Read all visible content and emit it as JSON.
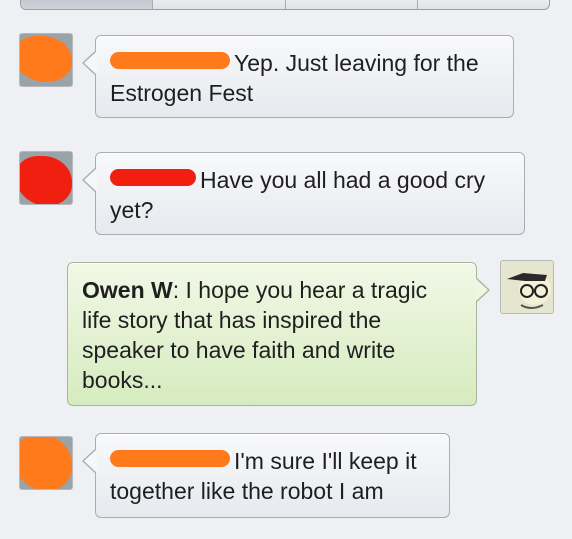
{
  "colors": {
    "orange_redaction": "#ff7a1a",
    "red_redaction": "#f01f10",
    "outgoing_bubble": "#dcefc8",
    "incoming_bubble": "#eef0f3"
  },
  "messages": [
    {
      "sender": "",
      "text": "Yep. Just leaving for the Estrogen Fest",
      "redacted": true,
      "redaction_color": "orange"
    },
    {
      "sender": "",
      "text": "Have you all had a good cry yet?",
      "redacted": true,
      "redaction_color": "red"
    },
    {
      "sender": "Owen W",
      "text": "I hope you hear a tragic life story that has inspired the speaker to have faith and write books...",
      "redacted": false
    },
    {
      "sender": "",
      "text": "I'm sure I'll keep it together like the robot I am",
      "redacted": true,
      "redaction_color": "orange"
    }
  ],
  "separator": ": "
}
